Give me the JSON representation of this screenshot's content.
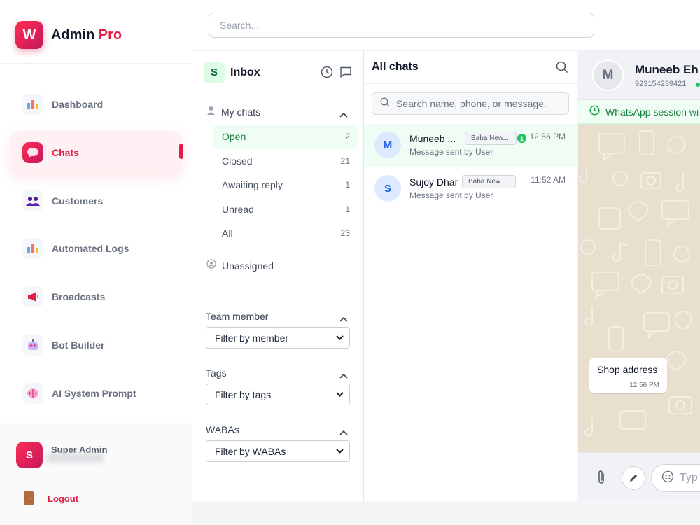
{
  "brand": {
    "logo_letter": "W",
    "name": "Admin",
    "suffix": "Pro"
  },
  "sidebar": {
    "items": [
      {
        "label": "Dashboard",
        "icon": "bar-chart-icon"
      },
      {
        "label": "Chats",
        "icon": "chat-bubble-icon",
        "active": true
      },
      {
        "label": "Customers",
        "icon": "users-icon"
      },
      {
        "label": "Automated Logs",
        "icon": "bar-chart-icon"
      },
      {
        "label": "Broadcasts",
        "icon": "megaphone-icon"
      },
      {
        "label": "Bot Builder",
        "icon": "robot-icon"
      },
      {
        "label": "AI System Prompt",
        "icon": "brain-icon"
      }
    ],
    "user": {
      "avatar_letter": "S",
      "name": "Super Admin"
    },
    "logout_label": "Logout"
  },
  "topbar": {
    "search_placeholder": "Search..."
  },
  "inbox": {
    "badge": "S",
    "title": "Inbox",
    "my_chats_label": "My chats",
    "statuses": [
      {
        "label": "Open",
        "count": "2"
      },
      {
        "label": "Closed",
        "count": "21"
      },
      {
        "label": "Awaiting reply",
        "count": "1"
      },
      {
        "label": "Unread",
        "count": "1"
      },
      {
        "label": "All",
        "count": "23"
      }
    ],
    "unassigned_label": "Unassigned",
    "team_member": {
      "title": "Team member",
      "select": "Filter by member"
    },
    "tags": {
      "title": "Tags",
      "select": "Filter by tags"
    },
    "wabas": {
      "title": "WABAs",
      "select": "Filter by WABAs"
    }
  },
  "chatlist": {
    "title": "All chats",
    "search_placeholder": "Search name, phone, or message.",
    "chats": [
      {
        "avatar": "M",
        "name": "Muneeb ...",
        "tag": "Baba New...",
        "sub": "Message sent by User",
        "time": "12:56 PM",
        "unread": "1"
      },
      {
        "avatar": "S",
        "name": "Sujoy Dhar",
        "tag": "Baba New ...",
        "sub": "Message sent by User",
        "time": "11:52 AM"
      }
    ]
  },
  "conversation": {
    "avatar": "M",
    "name": "Muneeb Eh",
    "phone": "923154239421",
    "session_text": "WhatsApp session wi",
    "message": {
      "text": "Shop address",
      "time": "12:56 PM"
    },
    "composer_placeholder": "Typ"
  },
  "colors": {
    "accent": "#e11d48",
    "whatsapp_green": "#22c55e",
    "wallpaper": "#e9dfcf"
  }
}
